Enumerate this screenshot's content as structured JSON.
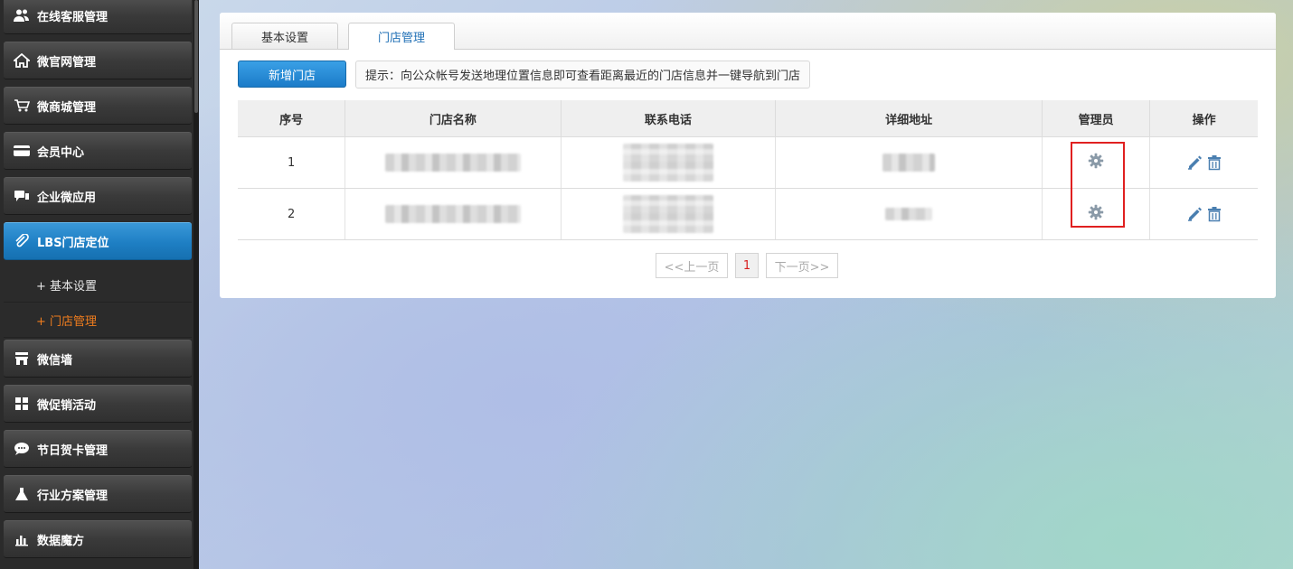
{
  "sidebar": {
    "items": [
      {
        "label": "在线客服管理",
        "icon": "users-icon"
      },
      {
        "label": "微官网管理",
        "icon": "home-icon"
      },
      {
        "label": "微商城管理",
        "icon": "cart-icon"
      },
      {
        "label": "会员中心",
        "icon": "card-icon"
      },
      {
        "label": "企业微应用",
        "icon": "chat-icon"
      },
      {
        "label": "LBS门店定位",
        "icon": "paperclip-icon"
      },
      {
        "label": "微信墙",
        "icon": "store-icon"
      },
      {
        "label": "微促销活动",
        "icon": "grid-icon"
      },
      {
        "label": "节日贺卡管理",
        "icon": "speech-bubble-icon"
      },
      {
        "label": "行业方案管理",
        "icon": "flask-icon"
      },
      {
        "label": "数据魔方",
        "icon": "bar-chart-icon"
      }
    ],
    "subitems": [
      "+ 基本设置",
      "+ 门店管理"
    ]
  },
  "tabs": [
    "基本设置",
    "门店管理"
  ],
  "add_button": "新增门店",
  "hint": "提示：向公众帐号发送地理位置信息即可查看距离最近的门店信息并一键导航到门店",
  "table": {
    "headers": [
      "序号",
      "门店名称",
      "联系电话",
      "详细地址",
      "管理员",
      "操作"
    ],
    "rows": [
      {
        "index": "1"
      },
      {
        "index": "2"
      }
    ]
  },
  "pager": {
    "prev": "<<上一页",
    "current": "1",
    "next": "下一页>>"
  },
  "colors": {
    "accent": "#1e7fc4",
    "current_sub": "#f07d1e",
    "highlight": "#e02020"
  }
}
